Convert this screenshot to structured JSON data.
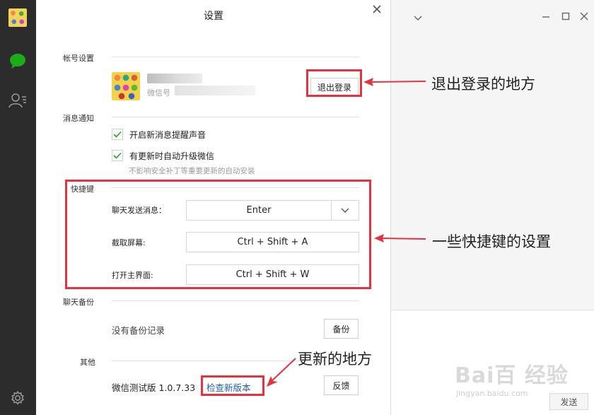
{
  "dialog": {
    "title": "设置"
  },
  "account": {
    "section_label": "帐号设置",
    "wechat_id_label": "微信号",
    "logout_button": "退出登录"
  },
  "notifications": {
    "section_label": "消息通知",
    "options": [
      {
        "label": "开启新消息提醒声音",
        "checked": true
      },
      {
        "label": "有更新时自动升级微信",
        "checked": true
      }
    ],
    "hint": "不影响安全补丁等重要更新的自动安装"
  },
  "shortcuts": {
    "section_label": "快捷键",
    "items": [
      {
        "label": "聊天发送消息：",
        "value": "Enter"
      },
      {
        "label": "截取屏幕:",
        "value": "Ctrl + Shift + A"
      },
      {
        "label": "打开主界面:",
        "value": "Ctrl + Shift + W"
      }
    ]
  },
  "backup": {
    "section_label": "聊天备份",
    "status": "没有备份记录",
    "button": "备份"
  },
  "other": {
    "section_label": "其他",
    "version": "微信测试版 1.0.7.33",
    "check_update": "检查新版本",
    "feedback_button": "反馈"
  },
  "chat_pane": {
    "send_button": "发送",
    "watermark": "Bai百 经验",
    "watermark_url": "jingyan.baidu.com"
  },
  "annotations": {
    "logout": "退出登录的地方",
    "shortcuts": "一些快捷键的设置",
    "update": "更新的地方"
  },
  "colors": {
    "sidebar": "#2c2c2c",
    "wechat_green": "#1aad19",
    "link_blue": "#1f5fa8",
    "annotation_red": "#e5323c"
  },
  "icons": {
    "sidebar": [
      "chat-bubble-icon",
      "contacts-icon",
      "gear-icon"
    ],
    "window": [
      "close-icon",
      "chevron-down-icon",
      "minimize-icon",
      "maximize-icon"
    ]
  }
}
